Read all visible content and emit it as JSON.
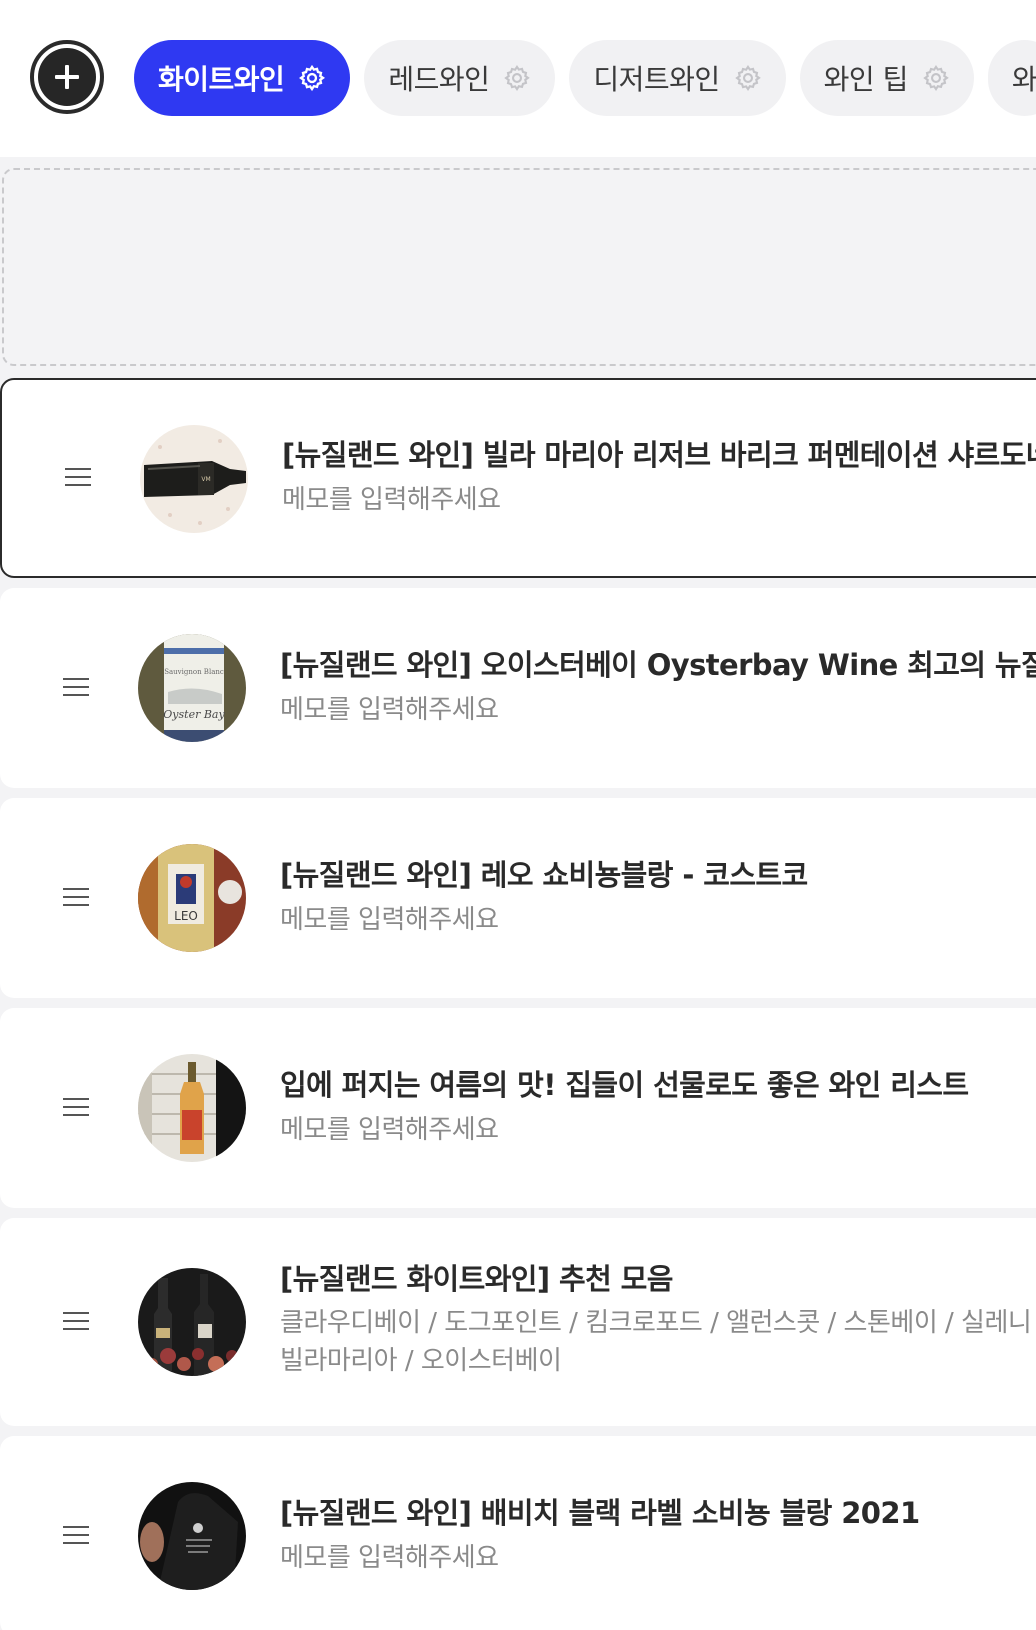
{
  "header": {
    "add_button_label": "+",
    "tabs": [
      {
        "label": "화이트와인",
        "active": true,
        "icon": "gear-icon"
      },
      {
        "label": "레드와인",
        "active": false,
        "icon": "gear-icon"
      },
      {
        "label": "디저트와인",
        "active": false,
        "icon": "gear-icon"
      },
      {
        "label": "와인 팁",
        "active": false,
        "icon": "gear-icon"
      },
      {
        "label": "와",
        "active": false,
        "icon": "gear-icon"
      }
    ]
  },
  "colors": {
    "accent": "#2f39f2",
    "background": "#f3f3f5",
    "card": "#ffffff"
  },
  "items": [
    {
      "title": "[뉴질랜드 와인] 빌라 마리아 리저브 바리크 퍼멘테이션 샤르도네",
      "memo": "메모를 입력해주세요",
      "thumbnail": "wine-bottle-photo"
    },
    {
      "title": "[뉴질랜드 와인] 오이스터베이 Oysterbay Wine 최고의 뉴질랜드",
      "memo": "메모를 입력해주세요",
      "thumbnail": "oyster-bay-label-photo"
    },
    {
      "title": "[뉴질랜드 와인] 레오 쇼비뇽블랑 - 코스트코",
      "memo": "메모를 입력해주세요",
      "thumbnail": "leo-label-photo"
    },
    {
      "title": "입에 퍼지는 여름의 맛! 집들이 선물로도 좋은 와인 리스트",
      "memo": "메모를 입력해주세요",
      "thumbnail": "orange-wine-bottle-photo"
    },
    {
      "title": "[뉴질랜드 화이트와인] 추천 모음",
      "memo_lines": [
        "클라우디베이 / 도그포인트 / 킴크로포드 / 앨런스콧 / 스톤베이 / 실레니",
        "빌라마리아 / 오이스터베이"
      ],
      "thumbnail": "bottles-and-flowers-photo"
    },
    {
      "title": "[뉴질랜드 와인] 배비치 블랙 라벨 소비뇽 블랑 2021",
      "memo": "메모를 입력해주세요",
      "thumbnail": "black-label-bottle-photo"
    }
  ]
}
